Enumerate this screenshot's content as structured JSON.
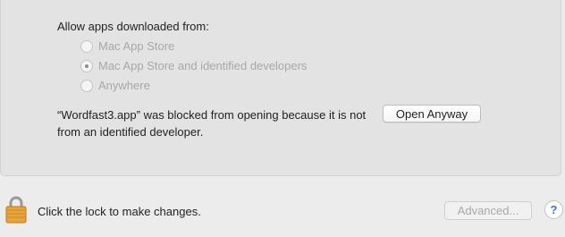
{
  "security": {
    "allow_heading": "Allow apps downloaded from:",
    "options": [
      {
        "label": "Mac App Store",
        "selected": false
      },
      {
        "label": "Mac App Store and identified developers",
        "selected": true
      },
      {
        "label": "Anywhere",
        "selected": false
      }
    ],
    "blocked_message": "“Wordfast3.app” was blocked from opening because it is not from an identified developer.",
    "open_anyway_label": "Open Anyway"
  },
  "footer": {
    "lock_label": "Click the lock to make changes.",
    "advanced_label": "Advanced...",
    "help_label": "?"
  },
  "colors": {
    "window_bg": "#ececec",
    "panel_bg": "#e3e3e3",
    "disabled_text": "#a8a8a8",
    "lock_gold": "#e8a43a"
  },
  "icons": {
    "lock": "lock-icon"
  }
}
